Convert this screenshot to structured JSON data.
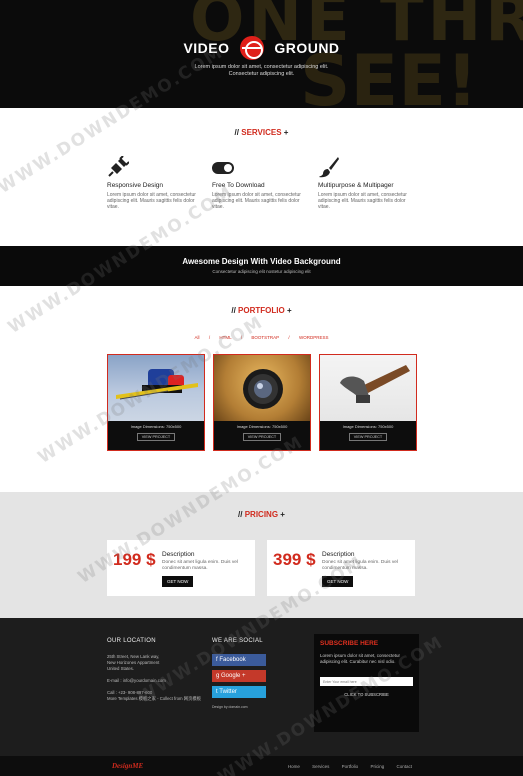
{
  "hero": {
    "brand_left": "VIDEO",
    "brand_right": "GROUND",
    "subtitle_line1": "Lorem ipsum dolor sit amet, consectetur adipiscing elit.",
    "subtitle_line2": "Consectetur adipiscing elit."
  },
  "services": {
    "title_prefix": "//",
    "title": "SERVICES",
    "title_suffix": "+",
    "items": [
      {
        "icon": "plug-icon",
        "title": "Responsive Design",
        "text": "Lorem ipsum dolor sit amet, consectetur adipiscing elit. Mauris sagittis felis dolor vitae."
      },
      {
        "icon": "toggle-icon",
        "title": "Free To Download",
        "text": "Lorem ipsum dolor sit amet, consectetur adipiscing elit. Mauris sagittis felis dolor vitae."
      },
      {
        "icon": "brush-icon",
        "title": "Multipurpose & Multipager",
        "text": "Lorem ipsum dolor sit amet, consectetur adipiscing elit. Mauris sagittis felis dolor vitae."
      }
    ]
  },
  "band": {
    "title": "Awesome Design With Video Background",
    "subtitle": "Consectetur adipiscing elit nostetur adipiscing elit"
  },
  "portfolio": {
    "title_prefix": "//",
    "title": "PORTFOLIO",
    "title_suffix": "+",
    "filters": [
      "All",
      "/",
      "HTML",
      "/",
      "BOOTSTRAP",
      "/",
      "WORDPRESS"
    ],
    "cards": [
      {
        "caption": "Image Dimensions: 750x500",
        "button": "VIEW PROJECT"
      },
      {
        "caption": "Image Dimensions: 750x500",
        "button": "VIEW PROJECT"
      },
      {
        "caption": "Image Dimensions: 750x500",
        "button": "VIEW PROJECT"
      }
    ]
  },
  "pricing": {
    "title_prefix": "//",
    "title": "PRICING",
    "title_suffix": "+",
    "plans": [
      {
        "price": "199 $",
        "label": "Description",
        "text": "Donec sit amet ligula enim. Duis vel condimentum massa.",
        "button": "GET NOW"
      },
      {
        "price": "399 $",
        "label": "Description",
        "text": "Donec sit amet ligula enim. Duis vel condimentum massa.",
        "button": "GET NOW"
      }
    ]
  },
  "footer": {
    "location_title": "OUR LOCATION",
    "address1": "25th Street, New Lank way,",
    "address2": "New Horizones Appartment",
    "address3": "United States.",
    "email": "E-mail : info@yourdomain.com",
    "call": "Call : +23- 908-897-600",
    "more": "More Templates 模板之家 - Collect from 网页模板",
    "social_title": "WE ARE SOCIAL",
    "facebook": "Facebook",
    "google": "Google +",
    "twitter": "Twitter",
    "design_by": "Design by domain.com",
    "subscribe_title": "SUBSCRIBE HERE",
    "subscribe_text": "Lorem ipsum dolor sit amet, consectetur adipiscing elit. Curabitur nec nisl odio.",
    "email_placeholder": "Enter Your email here",
    "subscribe_button": "CLICK TO SUBSCRIBE"
  },
  "bottom": {
    "logo": "DesignME",
    "nav": [
      "Home",
      "Services",
      "Portfolio",
      "Pricing",
      "Contact"
    ]
  },
  "watermark": "WWW.DOWNDEMO.COM",
  "colors": {
    "accent": "#d12b1e",
    "dark": "#0d0d0d",
    "footer": "#1d1d1d",
    "facebook": "#3b5b9b",
    "google": "#c4392a",
    "twitter": "#27a1dc"
  }
}
